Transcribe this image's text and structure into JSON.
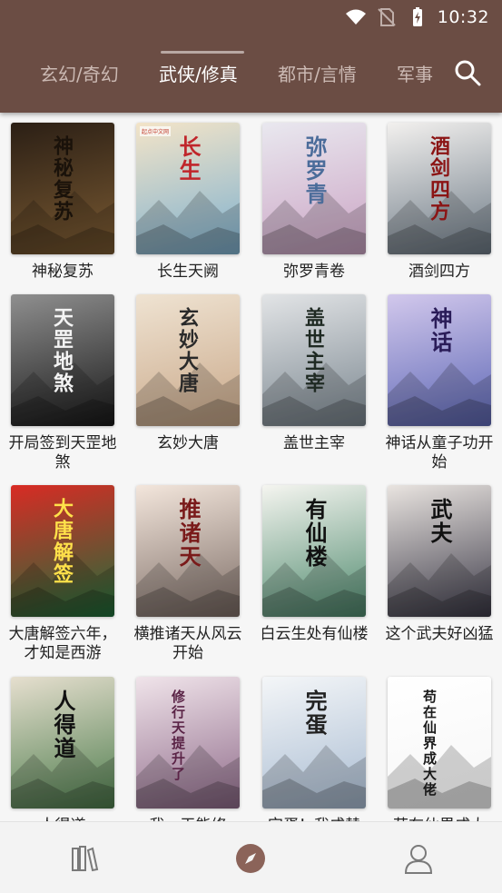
{
  "status": {
    "time": "10:32"
  },
  "tabs": [
    {
      "label": "玄幻/奇幻"
    },
    {
      "label": "武侠/修真"
    },
    {
      "label": "都市/言情"
    },
    {
      "label": "军事"
    }
  ],
  "books": [
    {
      "title": "神秘复苏",
      "cover_text": "神秘复苏",
      "colors": [
        "#2b1f15",
        "#7a5a32"
      ],
      "text_color": "#1a120a"
    },
    {
      "title": "长生天阙",
      "cover_text": "长生",
      "colors": [
        "#f3e4c8",
        "#7fb1cf"
      ],
      "text_color": "#c0262b",
      "publisher": "起点中文网"
    },
    {
      "title": "弥罗青卷",
      "cover_text": "弥罗青",
      "colors": [
        "#e9e8ef",
        "#cba4c4"
      ],
      "text_color": "#4b6c9a"
    },
    {
      "title": "酒剑四方",
      "cover_text": "酒剑四方",
      "colors": [
        "#f2f0ee",
        "#6d7a86"
      ],
      "text_color": "#8b1414"
    },
    {
      "title": "开局签到天罡地煞",
      "cover_text": "天罡地煞",
      "colors": [
        "#8f8f8f",
        "#1a1a1a"
      ],
      "text_color": "#f4f4f4"
    },
    {
      "title": "玄妙大唐",
      "cover_text": "玄妙大唐",
      "colors": [
        "#efe3d2",
        "#c9a889"
      ],
      "text_color": "#2a2a2a"
    },
    {
      "title": "盖世主宰",
      "cover_text": "盖世主宰",
      "colors": [
        "#e2e4e6",
        "#7b8790"
      ],
      "text_color": "#1f2a23"
    },
    {
      "title": "神话从童子功开始",
      "cover_text": "神话",
      "colors": [
        "#d2c8ec",
        "#5e68b6"
      ],
      "text_color": "#2a1c58"
    },
    {
      "title": "大唐解签六年，才知是西游",
      "cover_text": "大唐解签",
      "colors": [
        "#d92b24",
        "#1d6e3b"
      ],
      "text_color": "#ffe14a"
    },
    {
      "title": "横推诸天从风云开始",
      "cover_text": "推诸天",
      "colors": [
        "#f3e6dc",
        "#7d6d66"
      ],
      "text_color": "#7a1a1a"
    },
    {
      "title": "白云生处有仙楼",
      "cover_text": "有仙楼",
      "colors": [
        "#f5f5f0",
        "#4f8a6e"
      ],
      "text_color": "#111"
    },
    {
      "title": "这个武夫好凶猛",
      "cover_text": "武夫",
      "colors": [
        "#e9e4e0",
        "#3c3a48"
      ],
      "text_color": "#111"
    },
    {
      "title": "人得道",
      "cover_text": "人得道",
      "colors": [
        "#e6dfcf",
        "#4d7c4c"
      ],
      "text_color": "#111"
    },
    {
      "title": "我一天能修",
      "cover_text": "修行天提升了",
      "colors": [
        "#f0e4ea",
        "#8f6b8a"
      ],
      "text_color": "#5a2346"
    },
    {
      "title": "完蛋！我成替",
      "cover_text": "完蛋",
      "colors": [
        "#f4f6f8",
        "#a9bcd2"
      ],
      "text_color": "#222"
    },
    {
      "title": "苟在仙界成大",
      "cover_text": "苟在仙界成大佬",
      "colors": [
        "#ffffff",
        "#f6f6f6"
      ],
      "text_color": "#1a1a1a"
    }
  ],
  "bottom_nav": [
    {
      "icon": "bookshelf-icon"
    },
    {
      "icon": "discover-icon"
    },
    {
      "icon": "profile-icon"
    }
  ],
  "theme": {
    "primary": "#6b4d44",
    "accent": "#8b6359"
  }
}
